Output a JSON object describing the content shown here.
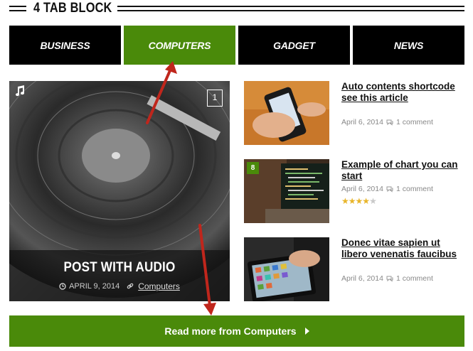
{
  "block": {
    "title": "4 TAB BLOCK"
  },
  "tabs": [
    {
      "label": "BUSINESS",
      "active": false
    },
    {
      "label": "COMPUTERS",
      "active": true
    },
    {
      "label": "GADGET",
      "active": false
    },
    {
      "label": "NEWS",
      "active": false
    }
  ],
  "featured": {
    "title": "POST WITH AUDIO",
    "date": "APRIL 9, 2014",
    "category": "Computers",
    "post_format_icon": "music-icon",
    "count": "1"
  },
  "posts": [
    {
      "title": "Auto contents shortcode see this article",
      "date": "April 6, 2014",
      "comments": "1 comment"
    },
    {
      "title": "Example of chart you can start",
      "date": "April 6, 2014",
      "comments": "1 comment",
      "badge": "8",
      "rating": 3.5,
      "rating_max": 5
    },
    {
      "title": "Donec vitae sapien ut libero venenatis faucibus",
      "date": "April 6, 2014",
      "comments": "1 comment"
    }
  ],
  "read_more": {
    "label": "Read more from Computers"
  },
  "colors": {
    "accent": "#4a8a0a",
    "tab_bg": "#000000",
    "annotation": "#c0261c",
    "star": "#e8b52a"
  }
}
